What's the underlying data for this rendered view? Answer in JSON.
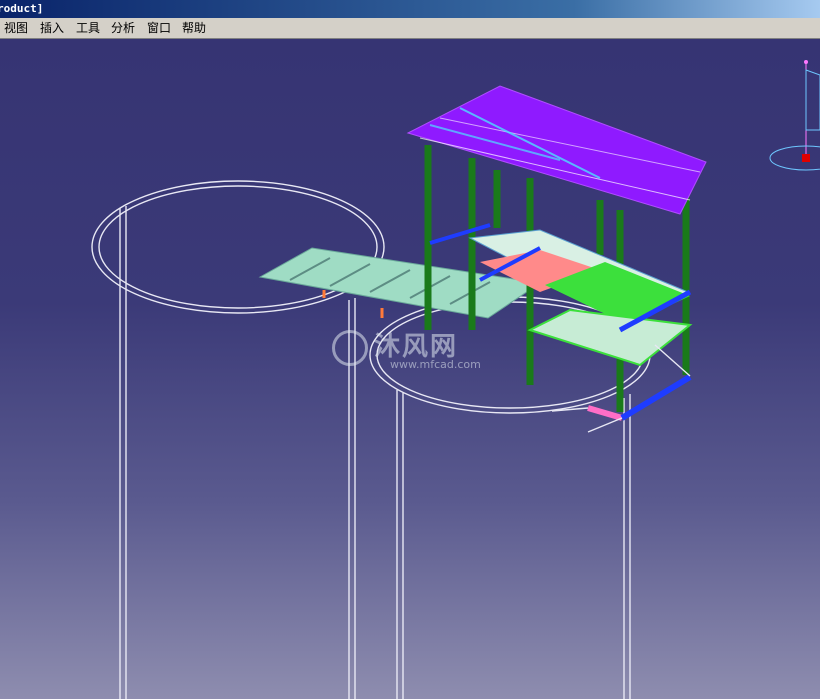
{
  "title_bar": {
    "text": "roduct]"
  },
  "menu": {
    "items": [
      {
        "id": "view",
        "label": "视图"
      },
      {
        "id": "insert",
        "label": "插入"
      },
      {
        "id": "tools",
        "label": "工具"
      },
      {
        "id": "analyze",
        "label": "分析"
      },
      {
        "id": "window",
        "label": "窗口"
      },
      {
        "id": "help",
        "label": "帮助"
      }
    ]
  },
  "watermark": {
    "brand": "沐风网",
    "url": "www.mfcad.com"
  },
  "colors": {
    "background_top": "#363473",
    "background_bottom": "#8e8daf",
    "wireframe": "#e8e8f4",
    "roof": "#8f1aff",
    "column": "#1a7a1a",
    "grating": "#9fdcc4",
    "deck_red": "#ff8a8a",
    "deck_green": "#3ce03c",
    "beam_blue": "#1e3cff",
    "brace_pink": "#ff6ec7"
  },
  "icons": [
    "compass-icon",
    "watermark-logo-icon"
  ]
}
